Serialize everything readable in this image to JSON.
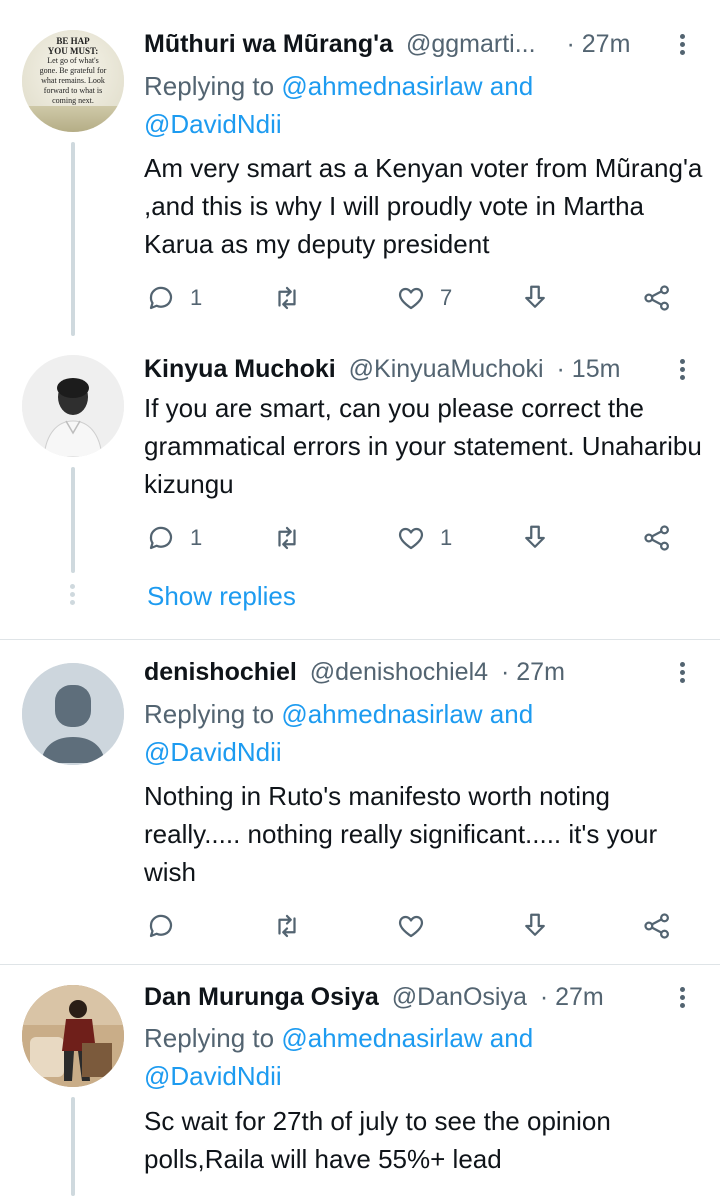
{
  "tweets": [
    {
      "name": "Mũthuri wa Mũrang'a",
      "handle": "@ggmarti...",
      "time": "· 27m",
      "replying_prefix": "Replying to ",
      "replying_mention1": "@ahmednasirlaw",
      "replying_and": " and",
      "replying_mention2": "@DavidNdii",
      "text": "Am very smart as a Kenyan voter from Mũrang'a ,and this is why I will proudly vote in Martha Karua as my deputy president",
      "reply_count": "1",
      "retweet_count": "",
      "like_count": "7",
      "avatar_text": [
        "BE HAP",
        "YOU MUST:",
        "Let go of what's",
        "gone. Be grateful for",
        "what remains. Look",
        "forward to what is",
        "coming next."
      ]
    },
    {
      "name": "Kinyua Muchoki",
      "handle": "@KinyuaMuchoki",
      "time": "· 15m",
      "text": "If you are smart, can you please correct the grammatical errors in your statement. Unaharibu kizungu",
      "reply_count": "1",
      "retweet_count": "",
      "like_count": "1"
    },
    {
      "name": "denishochiel",
      "handle": "@denishochiel4",
      "time": "· 27m",
      "replying_prefix": "Replying to ",
      "replying_mention1": "@ahmednasirlaw",
      "replying_and": " and",
      "replying_mention2": "@DavidNdii",
      "text": "Nothing in Ruto's manifesto worth noting really..... nothing really significant..... it's your wish",
      "reply_count": "",
      "retweet_count": "",
      "like_count": ""
    },
    {
      "name": "Dan Murunga Osiya",
      "handle": "@DanOsiya",
      "time": "· 27m",
      "replying_prefix": "Replying to ",
      "replying_mention1": "@ahmednasirlaw",
      "replying_and": " and",
      "replying_mention2": "@DavidNdii",
      "text": "Sc wait for 27th of july to see the opinion polls,Raila will have 55%+ lead"
    }
  ],
  "show_replies_label": "Show replies",
  "icons": {
    "reply": "reply-icon",
    "retweet": "retweet-icon",
    "like": "heart-icon",
    "bookmark": "download-icon",
    "share": "share-icon",
    "more": "more-vertical-icon"
  },
  "colors": {
    "accent": "#1d9bf0",
    "secondary_text": "#536471",
    "primary_text": "#0f1419",
    "divider": "#dfe4e7",
    "thread_line": "#cfd9de"
  }
}
